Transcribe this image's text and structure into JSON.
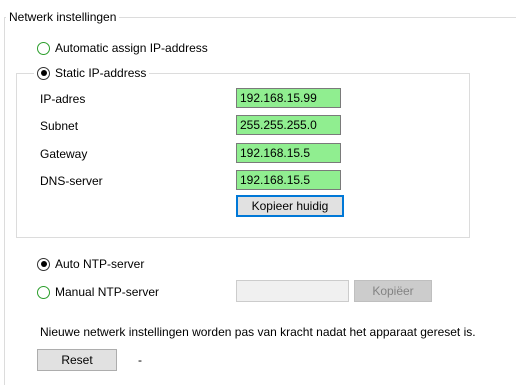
{
  "network_group": {
    "title": "Netwerk instellingen",
    "automatic_label": "Automatic assign IP-address",
    "automatic_checked": false,
    "static_label": "Static IP-address",
    "static_checked": true
  },
  "static_fields": [
    {
      "label": "IP-adres",
      "value": "192.168.15.99"
    },
    {
      "label": "Subnet",
      "value": "255.255.255.0"
    },
    {
      "label": "Gateway",
      "value": "192.168.15.5"
    },
    {
      "label": "DNS-server",
      "value": "192.168.15.5"
    }
  ],
  "copy_current_button": "Kopieer huidig",
  "ntp": {
    "auto_label": "Auto NTP-server",
    "auto_checked": true,
    "manual_label": "Manual NTP-server",
    "manual_checked": false,
    "manual_value": "",
    "copy_button": "Kopiëer"
  },
  "note": "Nieuwe netwerk instellingen worden pas van kracht nadat het apparaat gereset is.",
  "reset_button": "Reset",
  "reset_status": "-",
  "colors": {
    "field_background": "#90ee90",
    "radio_border_unchecked": "#2c9e2c",
    "primary_button_border": "#0078d7"
  }
}
